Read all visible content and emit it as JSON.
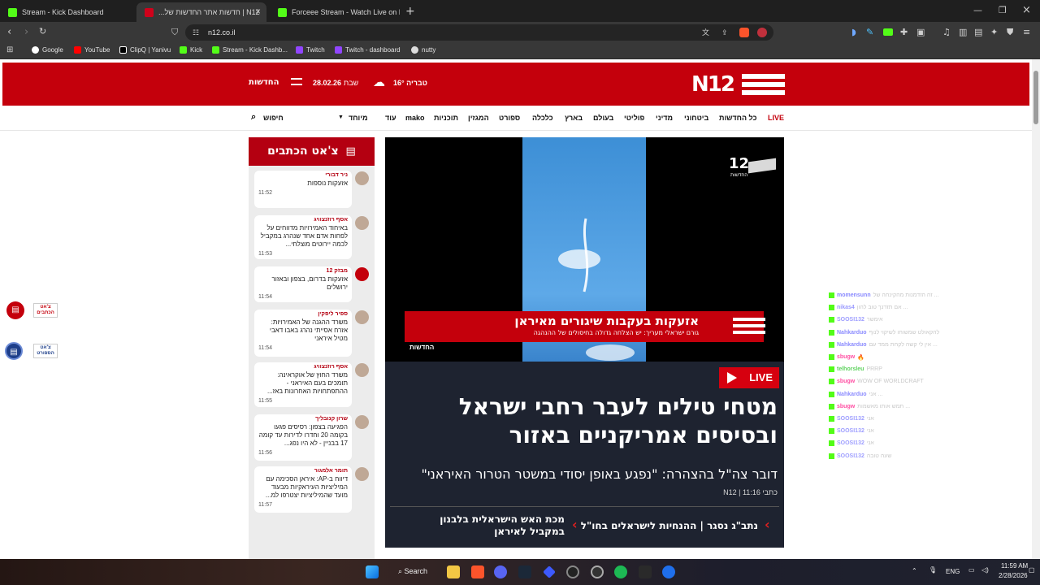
{
  "tabs": [
    {
      "label": "Stream - Kick Dashboard",
      "favicon": "kick-icon"
    },
    {
      "label": "N12 | חדשות אתר החדשות של...",
      "favicon": "n12-icon",
      "active": true
    },
    {
      "label": "Forceee Stream - Watch Live on Kick",
      "favicon": "kick-icon"
    }
  ],
  "address": "n12.co.il",
  "bookmarks": [
    "Google",
    "YouTube",
    "ClipQ | Yanivu",
    "Kick",
    "Stream - Kick Dashb...",
    "Twitch",
    "Twitch - dashboard",
    "nutty"
  ],
  "header": {
    "logo": "N12",
    "brand": "החדשות",
    "date": "28.02.26",
    "day": "שבת",
    "weather": "טבריה 16°"
  },
  "nav": {
    "items": [
      "LIVE",
      "כל החדשות",
      "ביטחוני",
      "מדיני",
      "פוליטי",
      "בעולם",
      "בארץ",
      "כלכלה",
      "ספורט",
      "המגזין",
      "תוכניות",
      "mako",
      "עוד",
      "מיוחד"
    ],
    "search": "חיפוש"
  },
  "reporters_chat": {
    "title": "צ'אט הכתבים",
    "messages": [
      {
        "author": "ניר דבורי",
        "text": "אזעקות נוספות",
        "time": "11:52"
      },
      {
        "author": "אסף רוזנצוויג",
        "text": "באיחוד האמירויות מדווחים על לפחות אדם אחד שנהרג במקביל לכמה יירוטים מוצלחי...",
        "time": "11:53"
      },
      {
        "author": "מבזק 12",
        "text": "אזעקות בדרום, בצפון ובאזור ירושלים",
        "time": "11:54"
      },
      {
        "author": "ספיר ליפקין",
        "text": "משרד ההגנה של האמירויות: אזרח אסייתי נהרג באבו דאבי מטיל איראני",
        "time": "11:54"
      },
      {
        "author": "אסף רוזנצוויג",
        "text": "משרד החוץ של אוקראינה: תומכים בעם האיראני - ההתפתחויות האחרונות באז...",
        "time": "11:55"
      },
      {
        "author": "שרון קנובליך",
        "text": "הפגיעה בצפון: רסיסים פגעו בקומה 20 וחדרו לדירות עד קומה 17 בבניין - לא היו נפג...",
        "time": "11:56"
      },
      {
        "author": "תומר אלמגור",
        "text": "דיווח ב-AP: איראן הסכימה עם המיליציות העיראקיות מבעוד מועד שהמיליציות יצטרפו למ...",
        "time": "11:57"
      }
    ]
  },
  "side_buttons": [
    {
      "label": "צ'אט הכתבים",
      "color": "#c4000c"
    },
    {
      "label": "צ'אט הספורט",
      "color": "#1e3f8a"
    }
  ],
  "hero": {
    "video_channel_logo": "12 החדשות",
    "banner_title": "אזעקות בעקבות שיגורים מאיראן",
    "banner_sub": "גורם ישראלי מעריך: יש הצלחה גדולה בחיסולים של ההנהגה",
    "banner_brand": "החדשות",
    "live": "LIVE",
    "headline": "מטחי טילים לעבר רחבי ישראל ובסיסים אמריקניים באזור",
    "subhead": "דובר צה\"ל בהצהרה: \"נפגע באופן יסודי במשטר הטרור האיראני\"",
    "byline": "כתבי N12 | 11:16",
    "related": [
      "נתב\"ג נסגר | ההנחיות לישראלים בחו\"ל",
      "מכת האש הישראלית בלבנון במקביל לאיראן"
    ]
  },
  "stream_chat_overlay": [
    {
      "name": "momensunn",
      "text": "זה הזדמנות מהקינחה של ...",
      "color": "#8888ff"
    },
    {
      "name": "nikas4",
      "text": "אם תזדנך טוב להון ...",
      "color": "#9a9aff"
    },
    {
      "name": "SOOSI132",
      "text": "אימשר",
      "color": "#a0a0ff"
    },
    {
      "name": "Nahkarduo",
      "text": "להקאולט שמשוחו לשיקוי לנוף",
      "color": "#8b8bff"
    },
    {
      "name": "Nahkarduo",
      "text": "אין לי קשה לקחת ממד עם ...",
      "color": "#8b8bff"
    },
    {
      "name": "sbugw",
      "text": "🔥",
      "color": "#ff4fa3"
    },
    {
      "name": "telhorsleu",
      "text": "PRRP",
      "color": "#5fd35f"
    },
    {
      "name": "sbugw",
      "text": "WOW OF WORLDCRAFT",
      "color": "#ff4fa3"
    },
    {
      "name": "Nahkarduo",
      "text": "אני ...",
      "color": "#8b8bff"
    },
    {
      "name": "sbugw",
      "text": "תמש אותו מאשמות ...",
      "color": "#ff4fa3"
    },
    {
      "name": "SOOSI132",
      "text": "אני",
      "color": "#a0a0ff"
    },
    {
      "name": "SOOSI132",
      "text": "אני",
      "color": "#a0a0ff"
    },
    {
      "name": "SOOSI132",
      "text": "אני",
      "color": "#a0a0ff"
    },
    {
      "name": "SOOSI132",
      "text": "שעה טובה",
      "color": "#a0a0ff"
    }
  ],
  "taskbar": {
    "search": "Search",
    "lang": "ENG",
    "time": "11:59 AM",
    "date": "2/28/2026"
  },
  "colors": {
    "brand_red": "#c4000c",
    "hero_bg": "#1e2330",
    "live_red": "#d6000f"
  }
}
